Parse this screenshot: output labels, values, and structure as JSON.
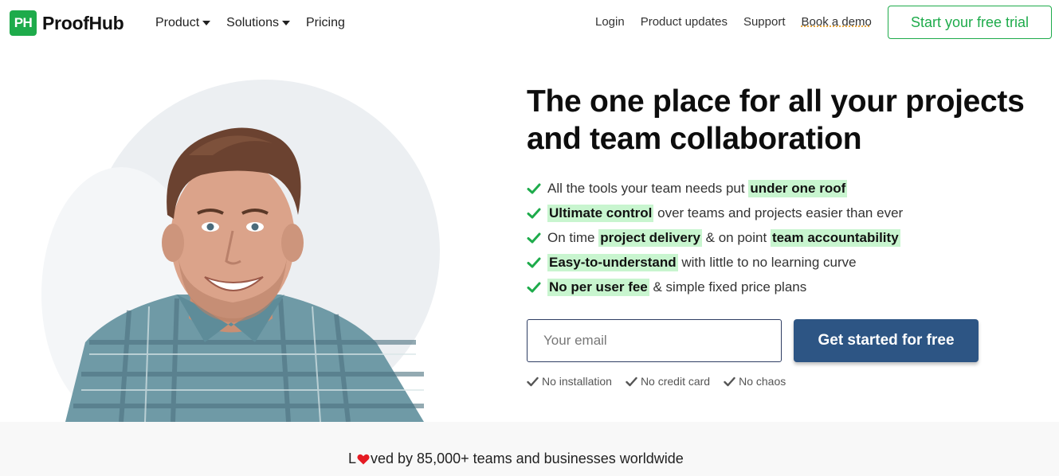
{
  "header": {
    "logo_mark": "PH",
    "logo_text": "ProofHub",
    "nav": [
      {
        "label": "Product",
        "has_dropdown": true
      },
      {
        "label": "Solutions",
        "has_dropdown": true
      },
      {
        "label": "Pricing",
        "has_dropdown": false
      }
    ],
    "links": [
      "Login",
      "Product updates",
      "Support",
      "Book a demo"
    ],
    "trial_button": "Start your free trial"
  },
  "hero": {
    "headline": "The one place for all your projects and team collaboration",
    "features": [
      {
        "before": "All the tools your team needs put ",
        "highlight": "under one roof",
        "after": ""
      },
      {
        "before": "",
        "highlight": "Ultimate control",
        "after": " over teams and projects easier than ever"
      },
      {
        "before": "On time ",
        "highlight": "project delivery",
        "mid": " & on point ",
        "highlight2": "team accountability"
      },
      {
        "before": "",
        "highlight": "Easy-to-understand",
        "after": " with little to no learning curve"
      },
      {
        "before": "",
        "highlight": "No per user fee",
        "after": " & simple fixed price plans"
      }
    ],
    "email_placeholder": "Your email",
    "cta_label": "Get started for free",
    "assurances": [
      "No installation",
      "No credit card",
      "No chaos"
    ]
  },
  "loved": {
    "prefix": "L",
    "suffix": "ved by 85,000+ teams and businesses worldwide"
  },
  "colors": {
    "brand_green": "#1eab4b",
    "cta_blue": "#2d5584",
    "highlight": "#c8f5cf",
    "heart": "#e51b23"
  },
  "icons": [
    "checkmark-icon",
    "caret-down-icon",
    "heart-icon"
  ]
}
